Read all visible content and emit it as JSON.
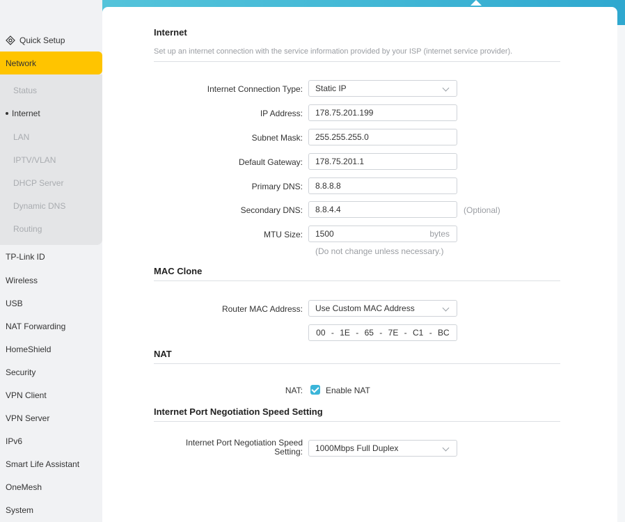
{
  "sidebar": {
    "quick_setup": "Quick Setup",
    "network": "Network",
    "network_items": [
      "Status",
      "Internet",
      "LAN",
      "IPTV/VLAN",
      "DHCP Server",
      "Dynamic DNS",
      "Routing"
    ],
    "items": [
      "TP-Link ID",
      "Wireless",
      "USB",
      "NAT Forwarding",
      "HomeShield",
      "Security",
      "VPN Client",
      "VPN Server",
      "IPv6",
      "Smart Life Assistant",
      "OneMesh",
      "System"
    ]
  },
  "internet": {
    "title": "Internet",
    "description": "Set up an internet connection with the service information provided by your ISP (internet service provider).",
    "connection_type_label": "Internet Connection Type:",
    "connection_type_value": "Static IP",
    "ip_label": "IP Address:",
    "ip_value": "178.75.201.199",
    "subnet_label": "Subnet Mask:",
    "subnet_value": "255.255.255.0",
    "gateway_label": "Default Gateway:",
    "gateway_value": "178.75.201.1",
    "primary_dns_label": "Primary DNS:",
    "primary_dns_value": "8.8.8.8",
    "secondary_dns_label": "Secondary DNS:",
    "secondary_dns_value": "8.8.4.4",
    "secondary_dns_hint": "(Optional)",
    "mtu_label": "MTU Size:",
    "mtu_value": "1500",
    "mtu_unit": "bytes",
    "mtu_hint": "(Do not change unless necessary.)"
  },
  "mac_clone": {
    "title": "MAC Clone",
    "router_mac_label": "Router MAC Address:",
    "router_mac_value": "Use Custom MAC Address",
    "mac_parts": [
      "00",
      "-",
      "1E",
      "-",
      "65",
      "-",
      "7E",
      "-",
      "C1",
      "-",
      "BC"
    ]
  },
  "nat": {
    "title": "NAT",
    "label": "NAT:",
    "checkbox_label": "Enable NAT",
    "checked": true
  },
  "port_speed": {
    "title": "Internet Port Negotiation Speed Setting",
    "label_line1": "Internet Port Negotiation Speed",
    "label_line2": "Setting:",
    "value": "1000Mbps Full Duplex"
  },
  "colors": {
    "accent": "#ffc400",
    "header": "#44b9d6",
    "checkbox": "#3bb5d9"
  }
}
